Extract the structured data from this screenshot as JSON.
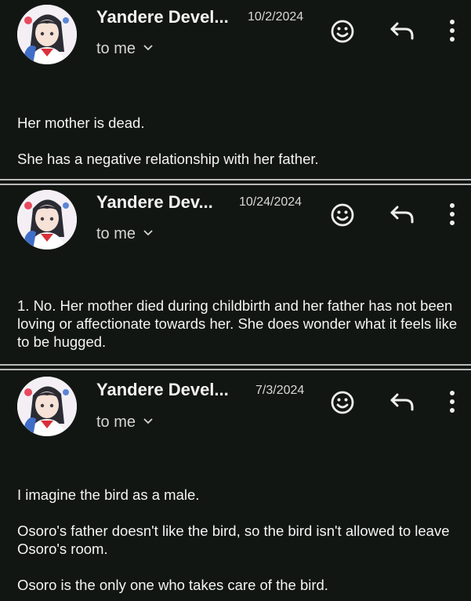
{
  "colors": {
    "background": "#121613",
    "text": "#f2f2f2",
    "divider": "#b9b9b9"
  },
  "emails": [
    {
      "sender": "Yandere Devel...",
      "date": "10/2/2024",
      "recipient": "to me",
      "icons": [
        "emoji-icon",
        "reply-icon",
        "more-vert-icon"
      ],
      "paragraphs": [
        "Her mother is dead.",
        "She has a negative relationship with her father."
      ]
    },
    {
      "sender": "Yandere Dev...",
      "date": "10/24/2024",
      "recipient": "to me",
      "icons": [
        "emoji-icon",
        "reply-icon",
        "more-vert-icon"
      ],
      "paragraphs": [
        "1. No. Her mother died during childbirth and her father has not been loving or affectionate towards her. She does wonder what it feels like to be hugged."
      ]
    },
    {
      "sender": "Yandere Devel...",
      "date": "7/3/2024",
      "recipient": "to me",
      "icons": [
        "emoji-icon",
        "reply-icon",
        "more-vert-icon"
      ],
      "paragraphs": [
        "I imagine the bird as a male.",
        "Osoro's father doesn't like the bird, so the bird isn't allowed to leave Osoro's room.",
        "Osoro is the only one who takes care of the bird."
      ]
    }
  ]
}
